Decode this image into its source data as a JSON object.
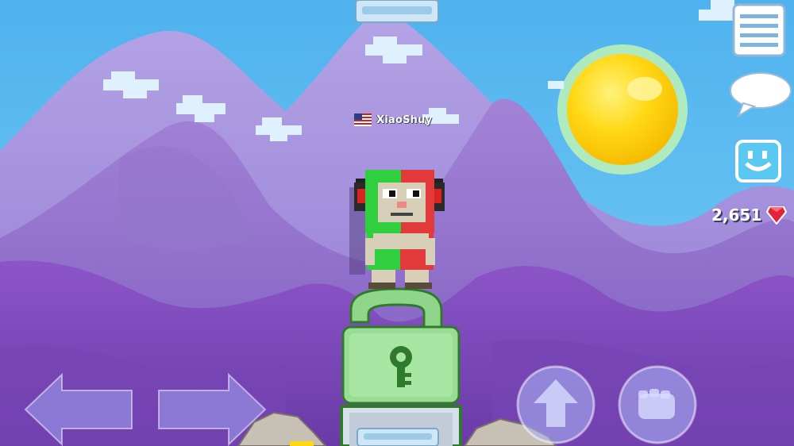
{
  "player": {
    "name": "XiaoShuy",
    "flag": "usa-flag-icon"
  },
  "hud": {
    "gem_count": "2,651",
    "gem_icon": "red-gem-icon",
    "menu_icon": "menu-list-icon",
    "chat_icon": "chat-bubble-icon",
    "emote_icon": "smiley-face-icon"
  },
  "controls": {
    "left": "left-arrow-icon",
    "right": "right-arrow-icon",
    "jump": "up-arrow-icon",
    "punch": "fist-icon"
  },
  "world": {
    "block_under_player": "green-world-lock",
    "sky_color": "#5ab8f0",
    "sun_color": "#ffd814"
  }
}
